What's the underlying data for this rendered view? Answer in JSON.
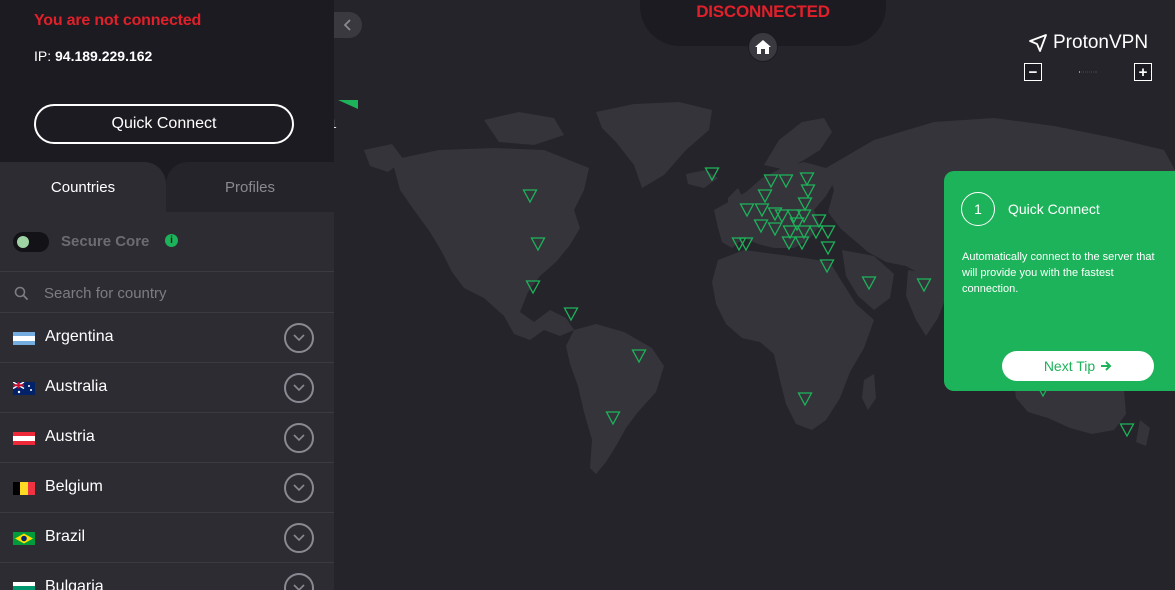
{
  "sidebar": {
    "status_title": "You are not connected",
    "ip_label": "IP:",
    "ip_value": "94.189.229.162",
    "quick_connect_label": "Quick Connect",
    "tabs": [
      {
        "label": "Countries",
        "active": true
      },
      {
        "label": "Profiles",
        "active": false
      }
    ],
    "secure_core": {
      "label": "Secure Core",
      "enabled": false,
      "info_icon": "info-icon"
    },
    "search": {
      "placeholder": "Search for country",
      "value": ""
    },
    "countries": [
      {
        "name": "Argentina",
        "flag": "argentina-flag"
      },
      {
        "name": "Australia",
        "flag": "australia-flag"
      },
      {
        "name": "Austria",
        "flag": "austria-flag"
      },
      {
        "name": "Belgium",
        "flag": "belgium-flag"
      },
      {
        "name": "Brazil",
        "flag": "brazil-flag"
      },
      {
        "name": "Bulgaria",
        "flag": "bulgaria-flag"
      }
    ]
  },
  "map": {
    "status_text": "DISCONNECTED",
    "side_number": "1",
    "brand_name": "ProtonVPN",
    "zoom": {
      "minus": "−",
      "plus": "+",
      "level_steps": 10,
      "current_step": 1
    },
    "marker_color": "#1db35a"
  },
  "tip": {
    "step": "1",
    "title": "Quick Connect",
    "text": "Automatically connect to the server that will provide you with the fastest connection.",
    "next_label": "Next Tip"
  },
  "colors": {
    "accent": "#1db35a",
    "danger": "#e0202a",
    "sidebar_bg": "#1c1b21",
    "map_bg": "#25242a",
    "land": "#35343b"
  }
}
